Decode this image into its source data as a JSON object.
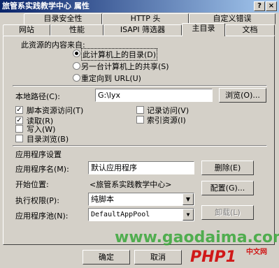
{
  "window": {
    "title": "旅管系实践教学中心 属性",
    "help": "?",
    "close": "×"
  },
  "tabs_row1": [
    "目录安全性",
    "HTTP 头",
    "自定义错误"
  ],
  "tabs_row2": [
    "网站",
    "性能",
    "ISAPI 筛选器",
    "主目录",
    "文档"
  ],
  "content_source": {
    "heading": "此资源的内容来自:",
    "options": [
      "此计算机上的目录(D)",
      "另一台计算机上的共享(S)",
      "重定向到 URL(U)"
    ],
    "selected": 0
  },
  "local_path": {
    "label": "本地路径(C):",
    "value": "G:\\lyx",
    "browse": "浏览(O)..."
  },
  "permissions": {
    "left": [
      {
        "label": "脚本资源访问(T)",
        "checked": true
      },
      {
        "label": "读取(R)",
        "checked": true
      },
      {
        "label": "写入(W)",
        "checked": false
      },
      {
        "label": "目录浏览(B)",
        "checked": false
      }
    ],
    "right": [
      {
        "label": "记录访问(V)",
        "checked": false
      },
      {
        "label": "索引资源(I)",
        "checked": false
      }
    ]
  },
  "app_settings": {
    "heading": "应用程序设置",
    "name_label": "应用程序名(M):",
    "name_value": "默认应用程序",
    "remove": "删除(E)",
    "start_label": "开始位置:",
    "start_value": "<旅管系实践教学中心>",
    "config": "配置(G)...",
    "exec_label": "执行权限(P):",
    "exec_value": "纯脚本",
    "pool_label": "应用程序池(N):",
    "pool_value": "DefaultAppPool",
    "unload": "卸载(L)"
  },
  "footer": {
    "ok": "确定",
    "cancel": "取消"
  },
  "watermark": {
    "site": "www.gaodaima.com",
    "brand": "PHP",
    "brand_num": "1",
    "brand_end": "中文网"
  },
  "colors": {
    "title_bar": "#0a246a",
    "face": "#d4d0c8",
    "watermark_green": "#3aa83a",
    "watermark_red": "#d01818"
  }
}
